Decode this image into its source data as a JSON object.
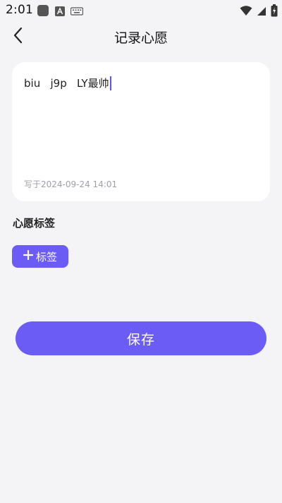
{
  "status_bar": {
    "time": "2:01"
  },
  "header": {
    "title": "记录心愿"
  },
  "wish": {
    "text": "biu   j9p   LY最帅",
    "written_at": "写于2024-09-24 14:01"
  },
  "tags": {
    "section_label": "心愿标签",
    "add_label": "标签"
  },
  "actions": {
    "save_label": "保存"
  },
  "colors": {
    "accent": "#6b5cf6",
    "background": "#f4f4f6",
    "card": "#ffffff",
    "caret": "#5b57e8"
  }
}
